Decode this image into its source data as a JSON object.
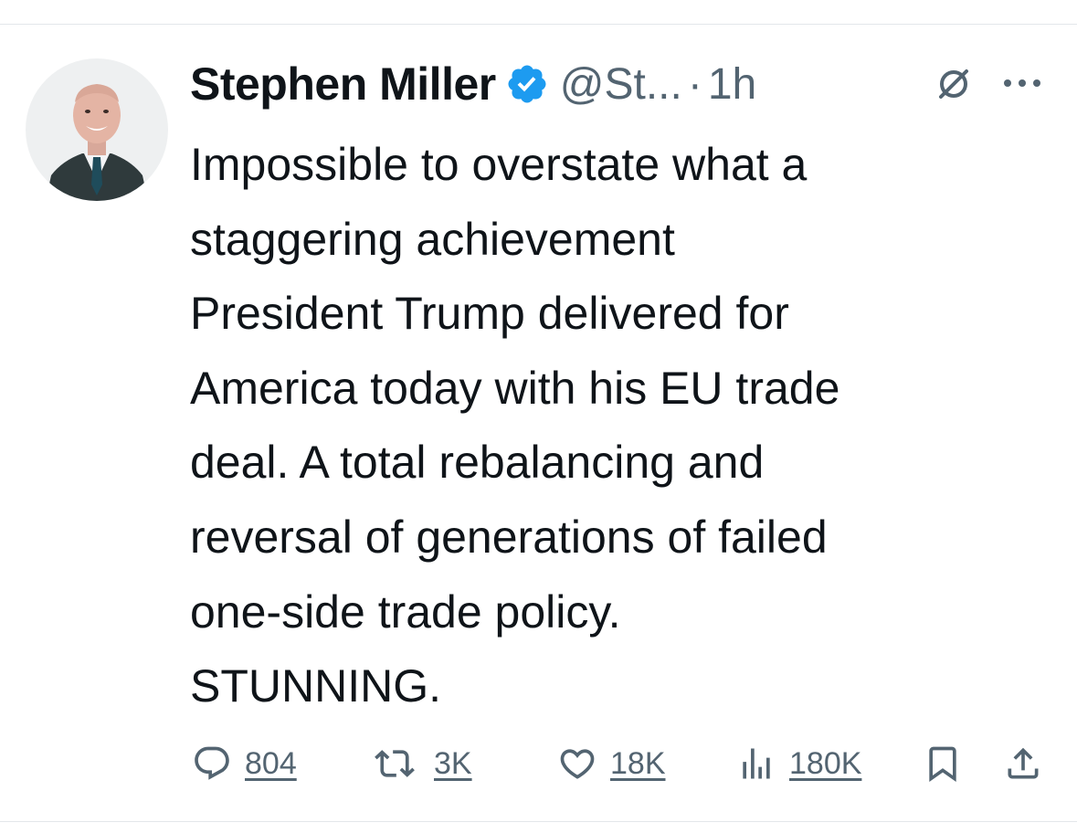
{
  "tweet": {
    "author_name": "Stephen Miller",
    "handle": "@St...",
    "separator": "·",
    "time": "1h",
    "verified": true,
    "text": "Impossible to overstate what a\nstaggering achievement\nPresident Trump delivered for\nAmerica today with his EU trade\ndeal. A total rebalancing and\nreversal of generations of failed\none-side trade policy.\nSTUNNING.",
    "stats": {
      "replies": "804",
      "reposts": "3K",
      "likes": "18K",
      "views": "180K"
    }
  },
  "icons": {
    "verified": "verified-badge-icon",
    "grok": "grok-icon",
    "more": "more-options-icon",
    "reply": "reply-icon",
    "repost": "repost-icon",
    "like": "heart-icon",
    "views": "views-icon",
    "bookmark": "bookmark-icon",
    "share": "share-icon"
  },
  "colors": {
    "text": "#0f1419",
    "secondary": "#536471",
    "verified": "#1d9bf0",
    "divider": "#e3e7ea"
  }
}
